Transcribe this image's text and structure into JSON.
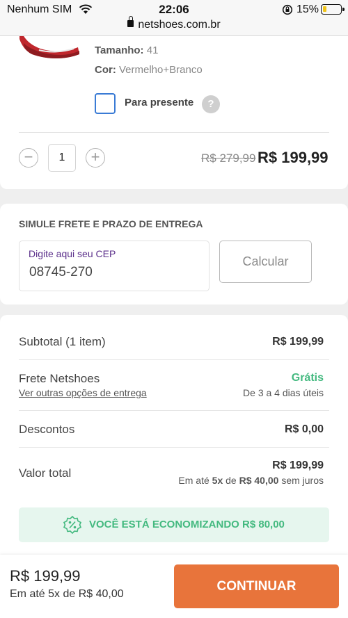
{
  "status_bar": {
    "carrier": "Nenhum SIM",
    "time": "22:06",
    "battery_pct": "15%"
  },
  "browser": {
    "url": "netshoes.com.br"
  },
  "product": {
    "size_label": "Tamanho:",
    "size_value": "41",
    "color_label": "Cor:",
    "color_value": "Vermelho+Branco",
    "gift_label": "Para presente",
    "gift_checked": false,
    "help_symbol": "?",
    "quantity": "1",
    "old_price": "R$ 279,99",
    "new_price": "R$ 199,99"
  },
  "shipping_sim": {
    "title": "SIMULE FRETE E PRAZO DE ENTREGA",
    "cep_label": "Digite aqui seu CEP",
    "cep_value": "08745-270",
    "calc_button": "Calcular"
  },
  "summary": {
    "subtotal_label": "Subtotal (1 item)",
    "subtotal_value": "R$ 199,99",
    "shipping_label": "Frete Netshoes",
    "shipping_link": "Ver outras opções de entrega",
    "shipping_value": "Grátis",
    "shipping_time": "De 3 a 4 dias úteis",
    "discount_label": "Descontos",
    "discount_value": "R$ 0,00",
    "total_label": "Valor total",
    "total_value": "R$ 199,99",
    "installment_prefix": "Em até",
    "installment_count": "5x",
    "installment_mid": "de",
    "installment_amount": "R$ 40,00",
    "installment_suffix": "sem juros",
    "savings_text": "VOCÊ ESTÁ ECONOMIZANDO R$ 80,00"
  },
  "footer": {
    "price": "R$ 199,99",
    "installments": "Em até 5x de R$ 40,00",
    "continue_button": "CONTINUAR"
  },
  "colors": {
    "accent_orange": "#e8743b",
    "success_green": "#43b97f",
    "checkbox_blue": "#3a7bd5",
    "cep_label_purple": "#5a2e8a",
    "shoe_red": "#c0272d"
  },
  "icons": [
    "wifi-icon",
    "rotation-lock-icon",
    "battery-icon",
    "lock-icon",
    "help-icon",
    "minus-icon",
    "plus-icon",
    "discount-percent-icon"
  ]
}
